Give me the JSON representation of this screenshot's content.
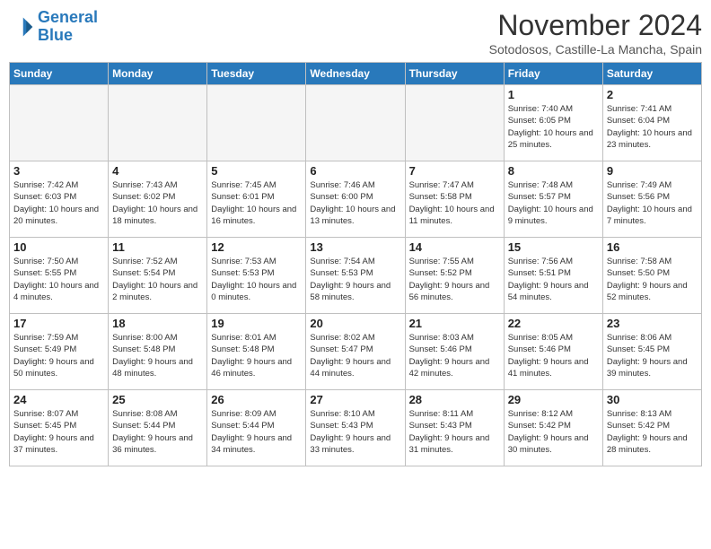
{
  "logo": {
    "line1": "General",
    "line2": "Blue"
  },
  "title": "November 2024",
  "subtitle": "Sotodosos, Castille-La Mancha, Spain",
  "weekdays": [
    "Sunday",
    "Monday",
    "Tuesday",
    "Wednesday",
    "Thursday",
    "Friday",
    "Saturday"
  ],
  "weeks": [
    [
      {
        "day": "",
        "info": ""
      },
      {
        "day": "",
        "info": ""
      },
      {
        "day": "",
        "info": ""
      },
      {
        "day": "",
        "info": ""
      },
      {
        "day": "",
        "info": ""
      },
      {
        "day": "1",
        "info": "Sunrise: 7:40 AM\nSunset: 6:05 PM\nDaylight: 10 hours and 25 minutes."
      },
      {
        "day": "2",
        "info": "Sunrise: 7:41 AM\nSunset: 6:04 PM\nDaylight: 10 hours and 23 minutes."
      }
    ],
    [
      {
        "day": "3",
        "info": "Sunrise: 7:42 AM\nSunset: 6:03 PM\nDaylight: 10 hours and 20 minutes."
      },
      {
        "day": "4",
        "info": "Sunrise: 7:43 AM\nSunset: 6:02 PM\nDaylight: 10 hours and 18 minutes."
      },
      {
        "day": "5",
        "info": "Sunrise: 7:45 AM\nSunset: 6:01 PM\nDaylight: 10 hours and 16 minutes."
      },
      {
        "day": "6",
        "info": "Sunrise: 7:46 AM\nSunset: 6:00 PM\nDaylight: 10 hours and 13 minutes."
      },
      {
        "day": "7",
        "info": "Sunrise: 7:47 AM\nSunset: 5:58 PM\nDaylight: 10 hours and 11 minutes."
      },
      {
        "day": "8",
        "info": "Sunrise: 7:48 AM\nSunset: 5:57 PM\nDaylight: 10 hours and 9 minutes."
      },
      {
        "day": "9",
        "info": "Sunrise: 7:49 AM\nSunset: 5:56 PM\nDaylight: 10 hours and 7 minutes."
      }
    ],
    [
      {
        "day": "10",
        "info": "Sunrise: 7:50 AM\nSunset: 5:55 PM\nDaylight: 10 hours and 4 minutes."
      },
      {
        "day": "11",
        "info": "Sunrise: 7:52 AM\nSunset: 5:54 PM\nDaylight: 10 hours and 2 minutes."
      },
      {
        "day": "12",
        "info": "Sunrise: 7:53 AM\nSunset: 5:53 PM\nDaylight: 10 hours and 0 minutes."
      },
      {
        "day": "13",
        "info": "Sunrise: 7:54 AM\nSunset: 5:53 PM\nDaylight: 9 hours and 58 minutes."
      },
      {
        "day": "14",
        "info": "Sunrise: 7:55 AM\nSunset: 5:52 PM\nDaylight: 9 hours and 56 minutes."
      },
      {
        "day": "15",
        "info": "Sunrise: 7:56 AM\nSunset: 5:51 PM\nDaylight: 9 hours and 54 minutes."
      },
      {
        "day": "16",
        "info": "Sunrise: 7:58 AM\nSunset: 5:50 PM\nDaylight: 9 hours and 52 minutes."
      }
    ],
    [
      {
        "day": "17",
        "info": "Sunrise: 7:59 AM\nSunset: 5:49 PM\nDaylight: 9 hours and 50 minutes."
      },
      {
        "day": "18",
        "info": "Sunrise: 8:00 AM\nSunset: 5:48 PM\nDaylight: 9 hours and 48 minutes."
      },
      {
        "day": "19",
        "info": "Sunrise: 8:01 AM\nSunset: 5:48 PM\nDaylight: 9 hours and 46 minutes."
      },
      {
        "day": "20",
        "info": "Sunrise: 8:02 AM\nSunset: 5:47 PM\nDaylight: 9 hours and 44 minutes."
      },
      {
        "day": "21",
        "info": "Sunrise: 8:03 AM\nSunset: 5:46 PM\nDaylight: 9 hours and 42 minutes."
      },
      {
        "day": "22",
        "info": "Sunrise: 8:05 AM\nSunset: 5:46 PM\nDaylight: 9 hours and 41 minutes."
      },
      {
        "day": "23",
        "info": "Sunrise: 8:06 AM\nSunset: 5:45 PM\nDaylight: 9 hours and 39 minutes."
      }
    ],
    [
      {
        "day": "24",
        "info": "Sunrise: 8:07 AM\nSunset: 5:45 PM\nDaylight: 9 hours and 37 minutes."
      },
      {
        "day": "25",
        "info": "Sunrise: 8:08 AM\nSunset: 5:44 PM\nDaylight: 9 hours and 36 minutes."
      },
      {
        "day": "26",
        "info": "Sunrise: 8:09 AM\nSunset: 5:44 PM\nDaylight: 9 hours and 34 minutes."
      },
      {
        "day": "27",
        "info": "Sunrise: 8:10 AM\nSunset: 5:43 PM\nDaylight: 9 hours and 33 minutes."
      },
      {
        "day": "28",
        "info": "Sunrise: 8:11 AM\nSunset: 5:43 PM\nDaylight: 9 hours and 31 minutes."
      },
      {
        "day": "29",
        "info": "Sunrise: 8:12 AM\nSunset: 5:42 PM\nDaylight: 9 hours and 30 minutes."
      },
      {
        "day": "30",
        "info": "Sunrise: 8:13 AM\nSunset: 5:42 PM\nDaylight: 9 hours and 28 minutes."
      }
    ]
  ]
}
